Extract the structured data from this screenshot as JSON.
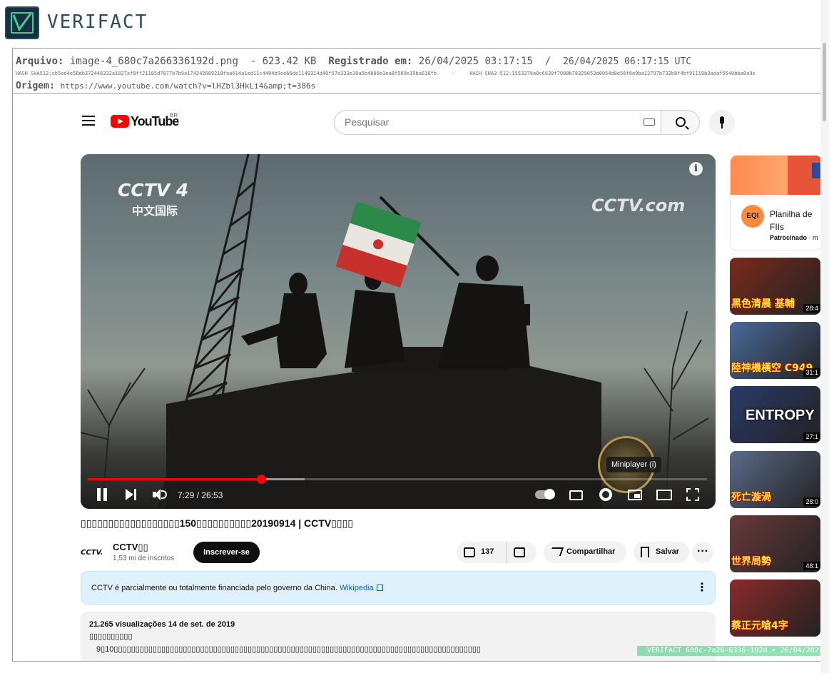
{
  "verifact": {
    "brand": "VERIFACT",
    "watermark": "VERIFACT 680c-7a26-6336-192d • 26/04/2025"
  },
  "evidence": {
    "file_label": "Arquivo:",
    "file_name": "image-4_680c7a266336192d.png",
    "file_size": "- 623.42 KB",
    "registered_label": "Registrado em:",
    "registered_local": "26/04/2025 03:17:15",
    "separator": "/",
    "registered_utc": "26/04/2025 06:17:15 UTC",
    "hash_sha512": "HASH SHA512:cb5ed4e58db372448332a1827af8ff21185d7077b7b9a174242689218faa614a1ed11c4484b5ee66de1149314d40f57e333e30a5b4800e3ea8f569e19ba616fb",
    "hash_sep": "-",
    "hash_sha3": "HASH SHA3-512:1553279a0c6930f7008b78329053d8054d8e56f8e9ba13797b732b8f4bf91119b3adaf5540bba0a9e",
    "origin_label": "Origem:",
    "origin_url": "https://www.youtube.com/watch?v=lHZbl3HkLi4&amp;t=386s"
  },
  "youtube": {
    "logo_word": "YouTube",
    "region": "BR",
    "search_placeholder": "Pesquisar",
    "video": {
      "cctv_logo": "CCTV 4",
      "cctv_logo_sub": "中文国际",
      "cctv_com": "CCTV.com",
      "tooltip": "Miniplayer (i)",
      "timecode": "7:29 / 26:53",
      "progress": 0.28,
      "buffered": 0.35
    },
    "title": "▯▯▯▯▯▯▯▯▯▯▯▯▯▯▯▯▯▯150▯▯▯▯▯▯▯▯▯▯20190914 | CCTV▯▯▯▯",
    "channel": {
      "avatar": "CCTV.",
      "name": "CCTV▯▯",
      "subscribers": "1,53 mi de inscritos",
      "subscribe": "Inscrever-se"
    },
    "actions": {
      "likes": "137",
      "share": "Compartilhar",
      "save": "Salvar",
      "more": "···"
    },
    "notice": {
      "text": "CCTV é parcialmente ou totalmente financiada pelo governo da China.",
      "link": "Wikipedia",
      "menu": "⋮"
    },
    "description": {
      "stats": "21.265 visualizações  14 de set. de 2019",
      "line1": "▯▯▯▯▯▯▯▯▯▯",
      "line2": "9▯10▯▯▯▯▯▯▯▯▯▯▯▯▯▯▯▯▯▯▯▯▯▯▯▯▯▯▯▯▯▯▯▯▯▯▯▯▯▯▯▯▯▯▯▯▯▯▯▯▯▯▯▯▯▯▯▯▯▯▯▯▯▯▯▯▯▯▯▯▯▯▯▯▯▯▯▯▯▯▯▯▯▯▯▯▯"
    },
    "sidebar": {
      "ad": {
        "avatar": "EQI",
        "title": "Planilha de FIIs",
        "sponsor_label": "Patrocinado",
        "sponsor_rest": "· m"
      },
      "videos": [
        {
          "caption": "黑色清晨 基輔",
          "duration": "28:4",
          "bg": "#7a2a1a"
        },
        {
          "caption": "陸神機橫空 C949",
          "duration": "31:1",
          "bg": "#4a6a9a"
        },
        {
          "caption": "ENTROPY",
          "duration": "27:1",
          "bg": "#2a3a6a"
        },
        {
          "caption": "死亡漩渦",
          "duration": "28:0",
          "bg": "#5a6a8a"
        },
        {
          "caption": "世界局勢",
          "duration": "48:1",
          "bg": "#6a3a3a"
        },
        {
          "caption": "蔡正元嗆4字",
          "duration": "",
          "bg": "#8a2a2a"
        }
      ]
    }
  }
}
